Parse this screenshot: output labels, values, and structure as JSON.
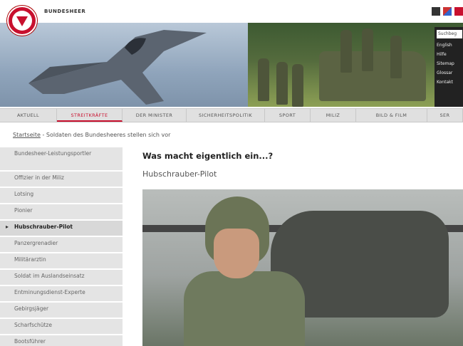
{
  "header": {
    "brand": "BUNDESHEER"
  },
  "side_links": {
    "search_placeholder": "Suchbeg",
    "links": [
      "English",
      "Hilfe",
      "Sitemap",
      "Glossar",
      "Kontakt"
    ]
  },
  "nav": {
    "tabs": [
      {
        "label": "AKTUELL",
        "active": false
      },
      {
        "label": "STREITKRÄFTE",
        "active": true
      },
      {
        "label": "DER MINISTER",
        "active": false
      },
      {
        "label": "SICHERHEITSPOLITIK",
        "active": false
      },
      {
        "label": "SPORT",
        "active": false
      },
      {
        "label": "MILIZ",
        "active": false
      },
      {
        "label": "BILD & FILM",
        "active": false
      },
      {
        "label": "SER",
        "active": false
      }
    ]
  },
  "breadcrumb": {
    "home": "Startseite",
    "separator": " - ",
    "current": "Soldaten des Bundesheeres stellen sich vor"
  },
  "sidebar": {
    "items": [
      {
        "label": "Bundesheer-Leistungsportler",
        "active": false
      },
      {
        "label": "Offizier in der Miliz",
        "active": false
      },
      {
        "label": "Lotsing",
        "active": false
      },
      {
        "label": "Pionier",
        "active": false
      },
      {
        "label": "Hubschrauber-Pilot",
        "active": true
      },
      {
        "label": "Panzergrenadier",
        "active": false
      },
      {
        "label": "Militärarztin",
        "active": false
      },
      {
        "label": "Soldat im Auslandseinsatz",
        "active": false
      },
      {
        "label": "Entminungsdienst-Experte",
        "active": false
      },
      {
        "label": "Gebirgsjäger",
        "active": false
      },
      {
        "label": "Scharfschütze",
        "active": false
      },
      {
        "label": "Bootsführer",
        "active": false
      }
    ]
  },
  "main": {
    "headline": "Was macht eigentlich ein...?",
    "subhead": "Hubschrauber-Pilot"
  },
  "colors": {
    "accent": "#c8102e",
    "nav_bg": "#e0e0e0",
    "sidebar_bg": "#e4e4e4"
  }
}
